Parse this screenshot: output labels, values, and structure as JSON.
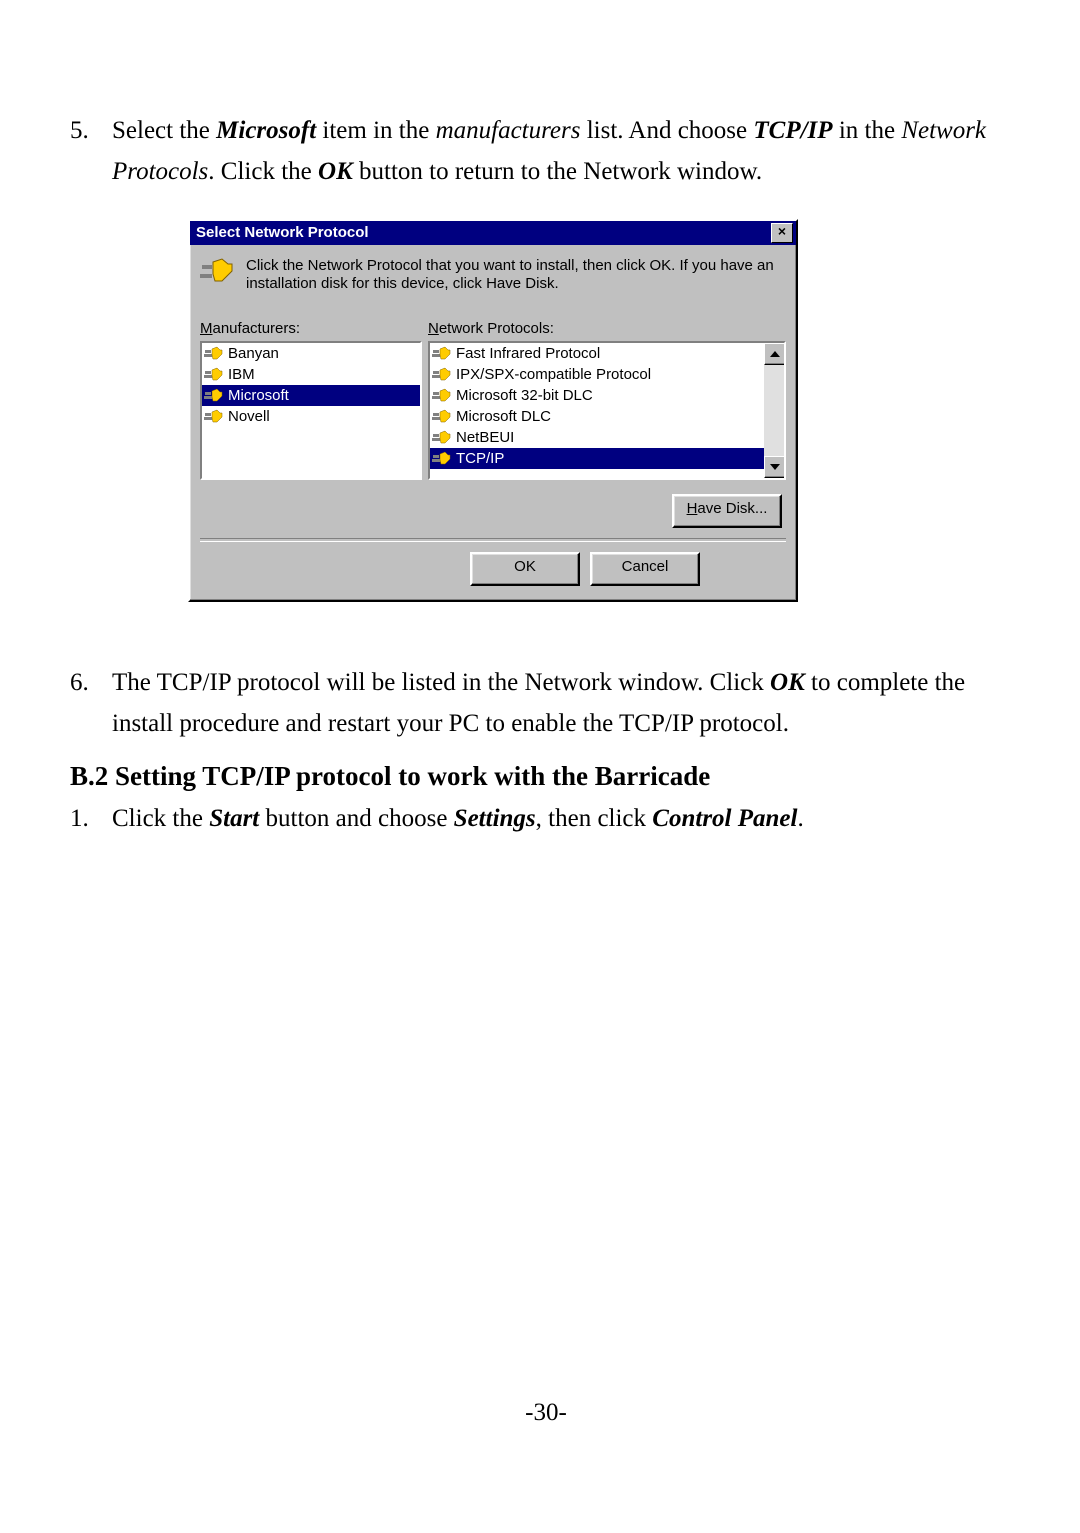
{
  "step5": {
    "num": "5.",
    "t1": "Select the ",
    "t2": "Microsoft",
    "t3": " item in the ",
    "t4": "manufacturers",
    "t5": " list. And choose ",
    "t6": "TCP/IP",
    "t7": " in the ",
    "t8": "Network Protocols",
    "t9": ". Click the ",
    "t10": "OK",
    "t11": " button to return to the Network window."
  },
  "dialog": {
    "title": "Select Network Protocol",
    "close_x": "×",
    "intro": "Click the Network Protocol that you want to install, then click OK. If you have an installation disk for this device, click Have Disk.",
    "manuf_label_u": "M",
    "manuf_label_rest": "anufacturers:",
    "proto_label_u": "N",
    "proto_label_rest": "etwork Protocols:",
    "manufacturers": [
      {
        "label": "Banyan",
        "selected": false
      },
      {
        "label": "IBM",
        "selected": false
      },
      {
        "label": "Microsoft",
        "selected": true
      },
      {
        "label": "Novell",
        "selected": false
      }
    ],
    "protocols": [
      {
        "label": "Fast Infrared Protocol",
        "selected": false
      },
      {
        "label": "IPX/SPX-compatible Protocol",
        "selected": false
      },
      {
        "label": "Microsoft 32-bit DLC",
        "selected": false
      },
      {
        "label": "Microsoft DLC",
        "selected": false
      },
      {
        "label": "NetBEUI",
        "selected": false
      },
      {
        "label": "TCP/IP",
        "selected": true
      }
    ],
    "have_disk_u": "H",
    "have_disk_rest": "ave Disk...",
    "ok": "OK",
    "cancel": "Cancel"
  },
  "step6": {
    "num": "6.",
    "t1": "The TCP/IP protocol will be listed in the Network window. Click ",
    "t2": "OK",
    "t3": " to complete the install procedure and restart your PC to enable the TCP/IP protocol."
  },
  "section": "B.2 Setting TCP/IP protocol to work with the Barricade",
  "step1": {
    "num": "1.",
    "t1": "Click the ",
    "t2": "Start",
    "t3": " button and choose ",
    "t4": "Settings",
    "t5": ", then click ",
    "t6": "Control Panel",
    "t7": "."
  },
  "page_number": "-30-"
}
